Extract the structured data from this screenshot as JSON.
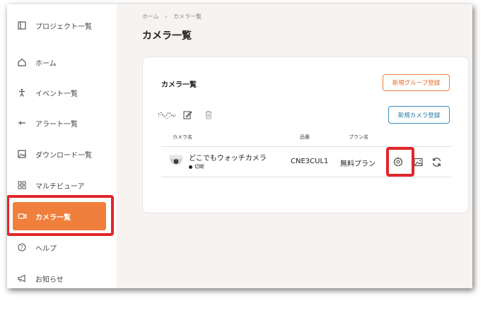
{
  "sidebar": {
    "items": [
      {
        "label": "プロジェクト一覧",
        "icon": "project-list-icon"
      },
      {
        "label": "ホーム",
        "icon": "home-icon"
      },
      {
        "label": "イベント一覧",
        "icon": "event-icon"
      },
      {
        "label": "アラート一覧",
        "icon": "alert-icon"
      },
      {
        "label": "ダウンロード一覧",
        "icon": "download-image-icon"
      },
      {
        "label": "マルチビューア",
        "icon": "grid-icon"
      },
      {
        "label": "カメラ一覧",
        "icon": "camera-icon",
        "active": true
      },
      {
        "label": "ヘルプ",
        "icon": "help-icon"
      },
      {
        "label": "お知らせ",
        "icon": "megaphone-icon"
      }
    ]
  },
  "breadcrumb": {
    "home": "ホーム",
    "separator": "›",
    "current": "カメラ一覧"
  },
  "page_title": "カメラ一覧",
  "card": {
    "title": "カメラ一覧",
    "new_group_button": "新規グループ登録",
    "new_camera_button": "新規カメラ登録",
    "table": {
      "headers": {
        "camera_name": "カメラ名",
        "product_no": "品番",
        "plan_name": "プラン名"
      },
      "rows": [
        {
          "name": "どこでもウォッチカメラ",
          "status": "切断",
          "product_no": "CNE3CUL1",
          "plan": "無料プラン"
        }
      ]
    }
  },
  "colors": {
    "accent": "#f07f3c",
    "highlight": "#e1262b",
    "blue": "#3b8ec0"
  }
}
